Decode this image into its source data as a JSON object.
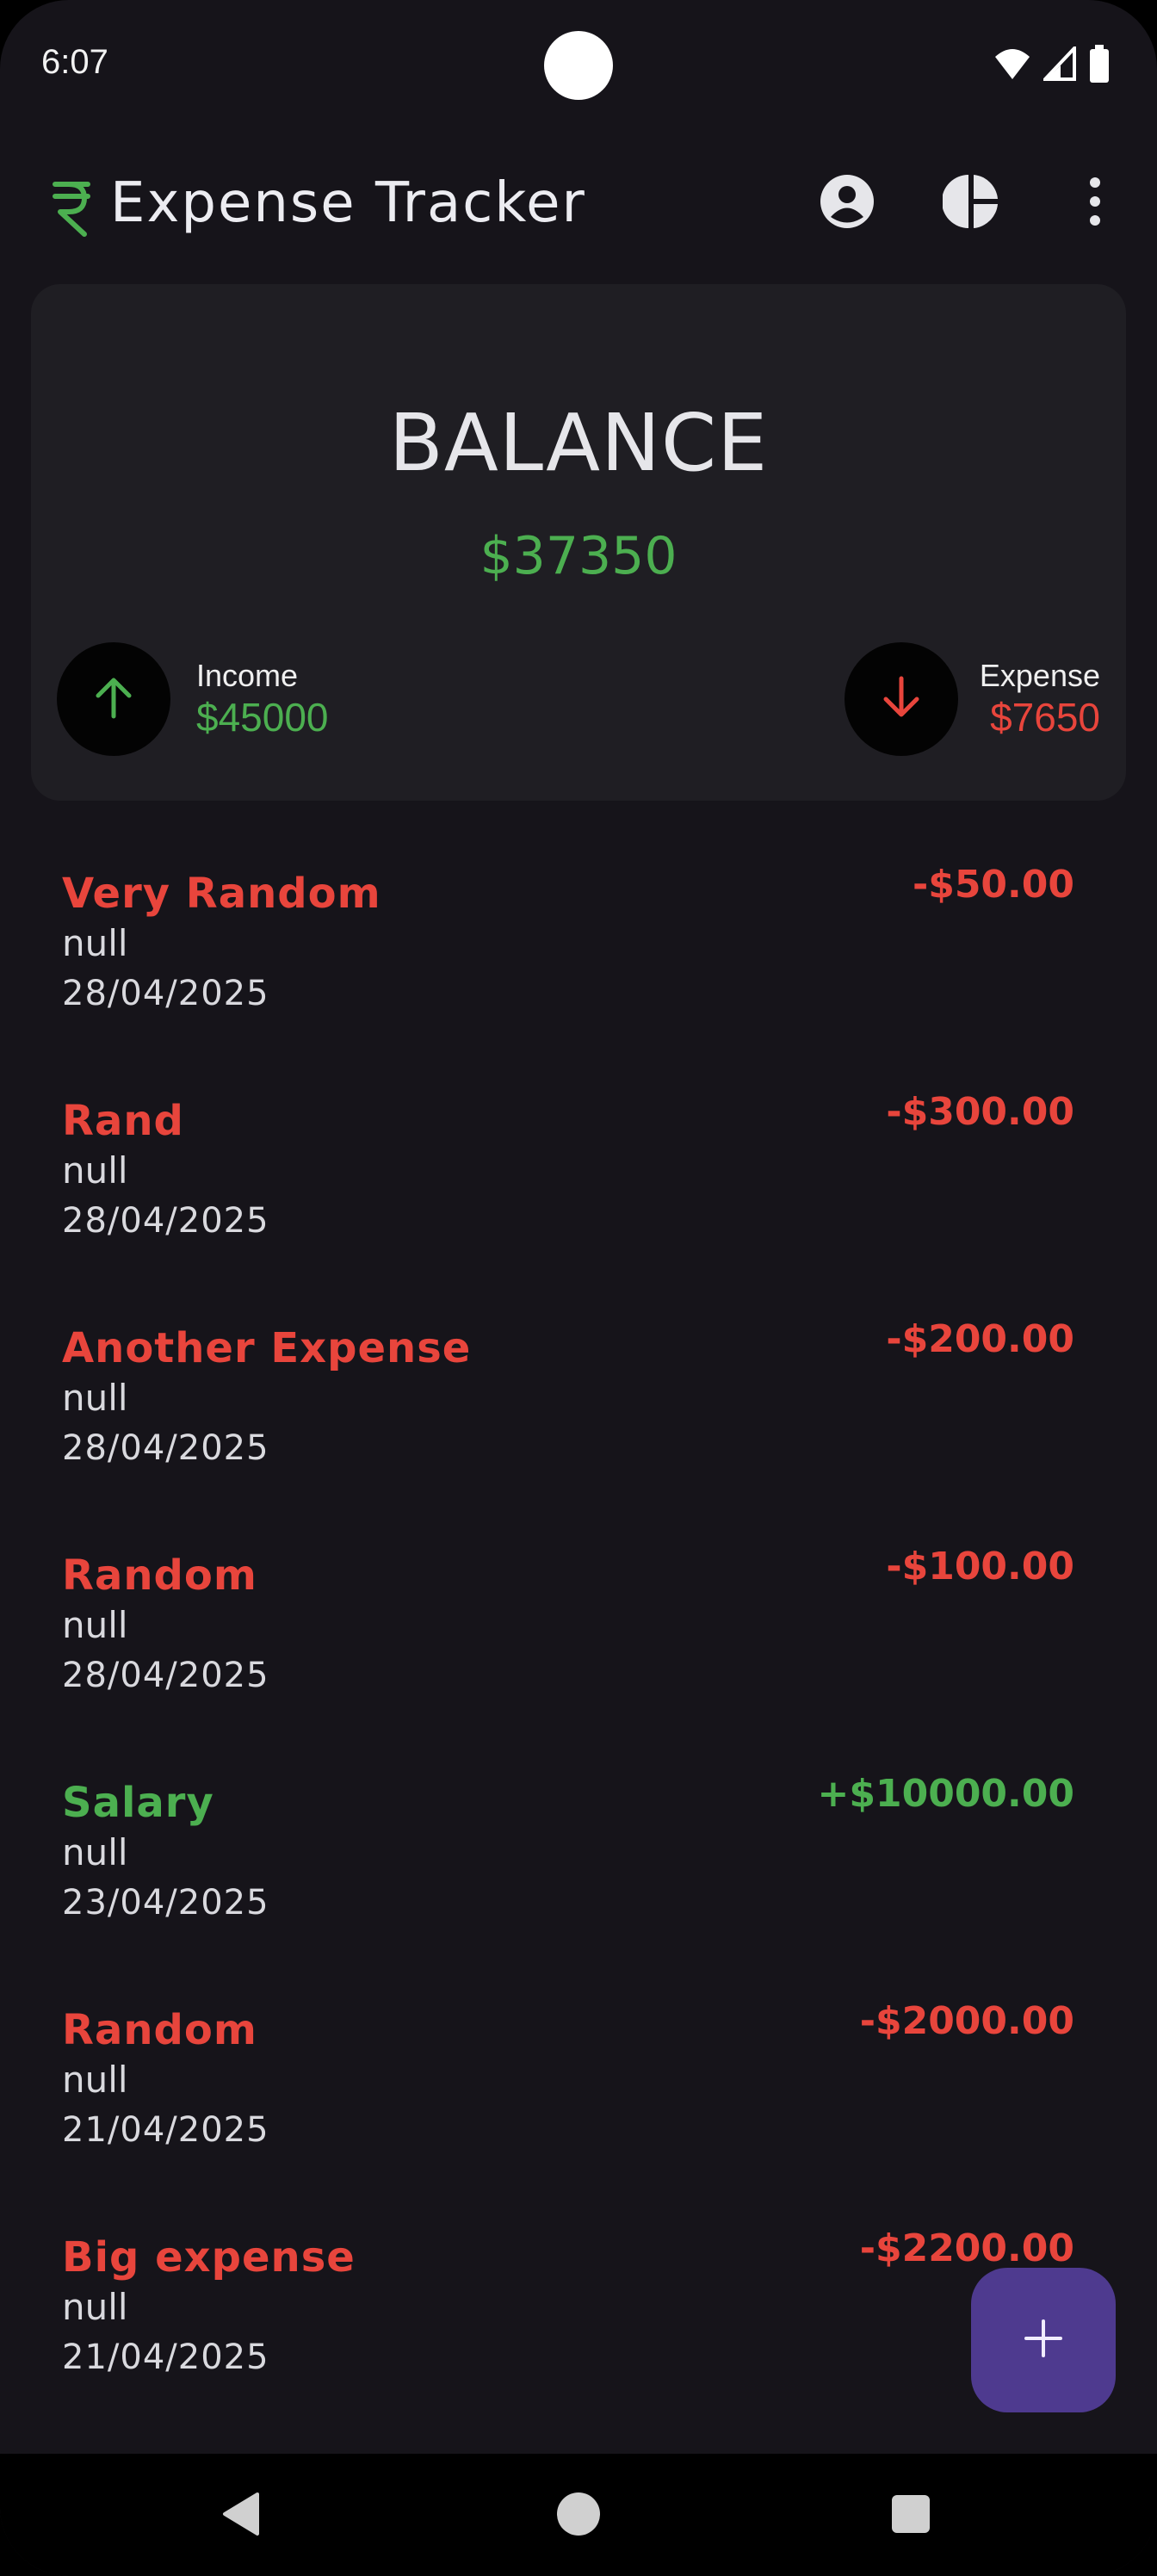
{
  "status_bar": {
    "time": "6:07",
    "icons": [
      "wifi-icon",
      "signal-icon",
      "battery-icon"
    ]
  },
  "app_bar": {
    "logo_icon": "rupee-icon",
    "title": "Expense Tracker",
    "actions": [
      "account-circle-icon",
      "pie-chart-icon",
      "more-vert-icon"
    ]
  },
  "balance_card": {
    "title": "BALANCE",
    "balance": "$37350",
    "income": {
      "label": "Income",
      "value": "$45000",
      "icon": "arrow-up-icon"
    },
    "expense": {
      "label": "Expense",
      "value": "$7650",
      "icon": "arrow-down-icon"
    }
  },
  "transactions": [
    {
      "title": "Very Random",
      "note": "null",
      "date": "28/04/2025",
      "amount": "-$50.00",
      "type": "expense"
    },
    {
      "title": "Rand",
      "note": "null",
      "date": "28/04/2025",
      "amount": "-$300.00",
      "type": "expense"
    },
    {
      "title": "Another Expense",
      "note": "null",
      "date": "28/04/2025",
      "amount": "-$200.00",
      "type": "expense"
    },
    {
      "title": "Random",
      "note": "null",
      "date": "28/04/2025",
      "amount": "-$100.00",
      "type": "expense"
    },
    {
      "title": "Salary",
      "note": "null",
      "date": "23/04/2025",
      "amount": "+$10000.00",
      "type": "income"
    },
    {
      "title": "Random",
      "note": "null",
      "date": "21/04/2025",
      "amount": "-$2000.00",
      "type": "expense"
    },
    {
      "title": "Big expense",
      "note": "null",
      "date": "21/04/2025",
      "amount": "-$2200.00",
      "type": "expense"
    }
  ],
  "fab": {
    "icon": "plus-icon"
  },
  "nav_bar": {
    "buttons": [
      "back-icon",
      "home-icon",
      "recents-icon"
    ]
  },
  "colors": {
    "background": "#16141a",
    "card": "#1f1e23",
    "income": "#4caf50",
    "expense": "#e8453c",
    "fab": "#4e3a8f"
  }
}
